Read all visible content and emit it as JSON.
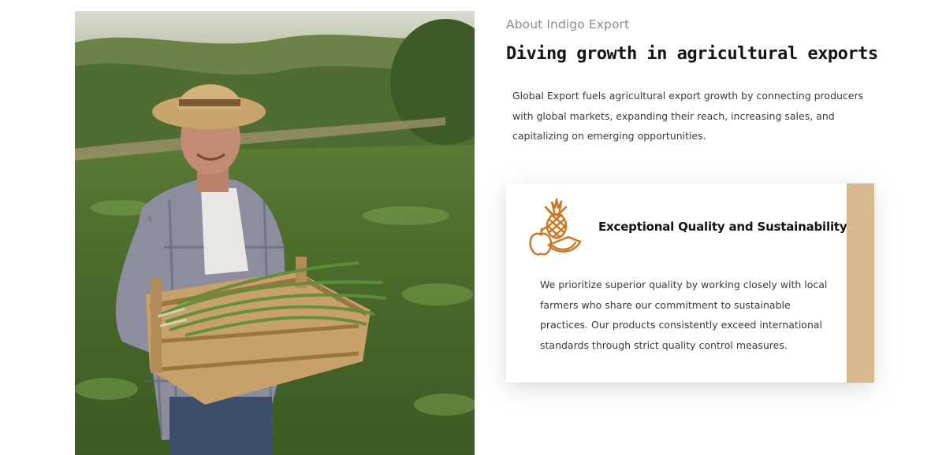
{
  "hero_image": {
    "description_icon": "farmer-photo"
  },
  "about": {
    "eyebrow": "About Indigo Export",
    "headline": "Diving growth in agricultural exports",
    "intro": "Global Export fuels agricultural export growth by connecting producers with global markets, expanding their reach, increasing sales, and capitalizing on emerging opportunities."
  },
  "feature_card": {
    "icon": "fruit-icon",
    "title": "Exceptional Quality and Sustainability",
    "body": "We prioritize superior quality by working closely with local farmers who share our commitment to sustainable practices. Our products consistently exceed international standards through strict quality control measures.",
    "accent_color": "#d7b88f",
    "icon_color": "#d0741c"
  }
}
